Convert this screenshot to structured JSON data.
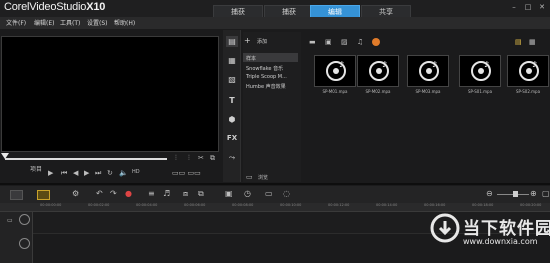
{
  "app": {
    "logo_prefix": "Corel",
    "logo_name": "VideoStudio",
    "logo_version": "X10"
  },
  "tabs": [
    {
      "label": "捕获"
    },
    {
      "label": "编辑"
    },
    {
      "label": "共享"
    }
  ],
  "selected_tab_index": 1,
  "menu": [
    {
      "label": "文件(F)"
    },
    {
      "label": "编辑(E)"
    },
    {
      "label": "工具(T)"
    },
    {
      "label": "设置(S)"
    },
    {
      "label": "帮助(H)"
    }
  ],
  "player": {
    "mode_label": "项目"
  },
  "library": {
    "add_label": "添加",
    "folders": [
      {
        "label": "样本"
      },
      {
        "label": "Snowflake 音乐"
      },
      {
        "label": "Triple Scoop M..."
      },
      {
        "label": "Humbe 声音效果"
      }
    ],
    "selected_index": 0,
    "browse_label": "浏览"
  },
  "gallery": {
    "items": [
      {
        "label": "SP-M01.mpa"
      },
      {
        "label": "SP-M02.mpa"
      },
      {
        "label": "SP-M03.mpa"
      },
      {
        "label": "SP-S01.mpa"
      },
      {
        "label": "SP-S02.mpa"
      }
    ]
  },
  "ruler": {
    "ticks": [
      "00:00:00:00",
      "00:00:02:00",
      "00:00:04:00",
      "00:00:06:00",
      "00:00:08:00",
      "00:00:10:00",
      "00:00:12:00",
      "00:00:14:00",
      "00:00:16:00",
      "00:00:18:00",
      "00:00:20:00"
    ]
  },
  "watermark": {
    "text": "当下软件园",
    "url": "www.downxia.com"
  },
  "colors": {
    "accent": "#3592d6",
    "background": "#1b1b1c"
  }
}
